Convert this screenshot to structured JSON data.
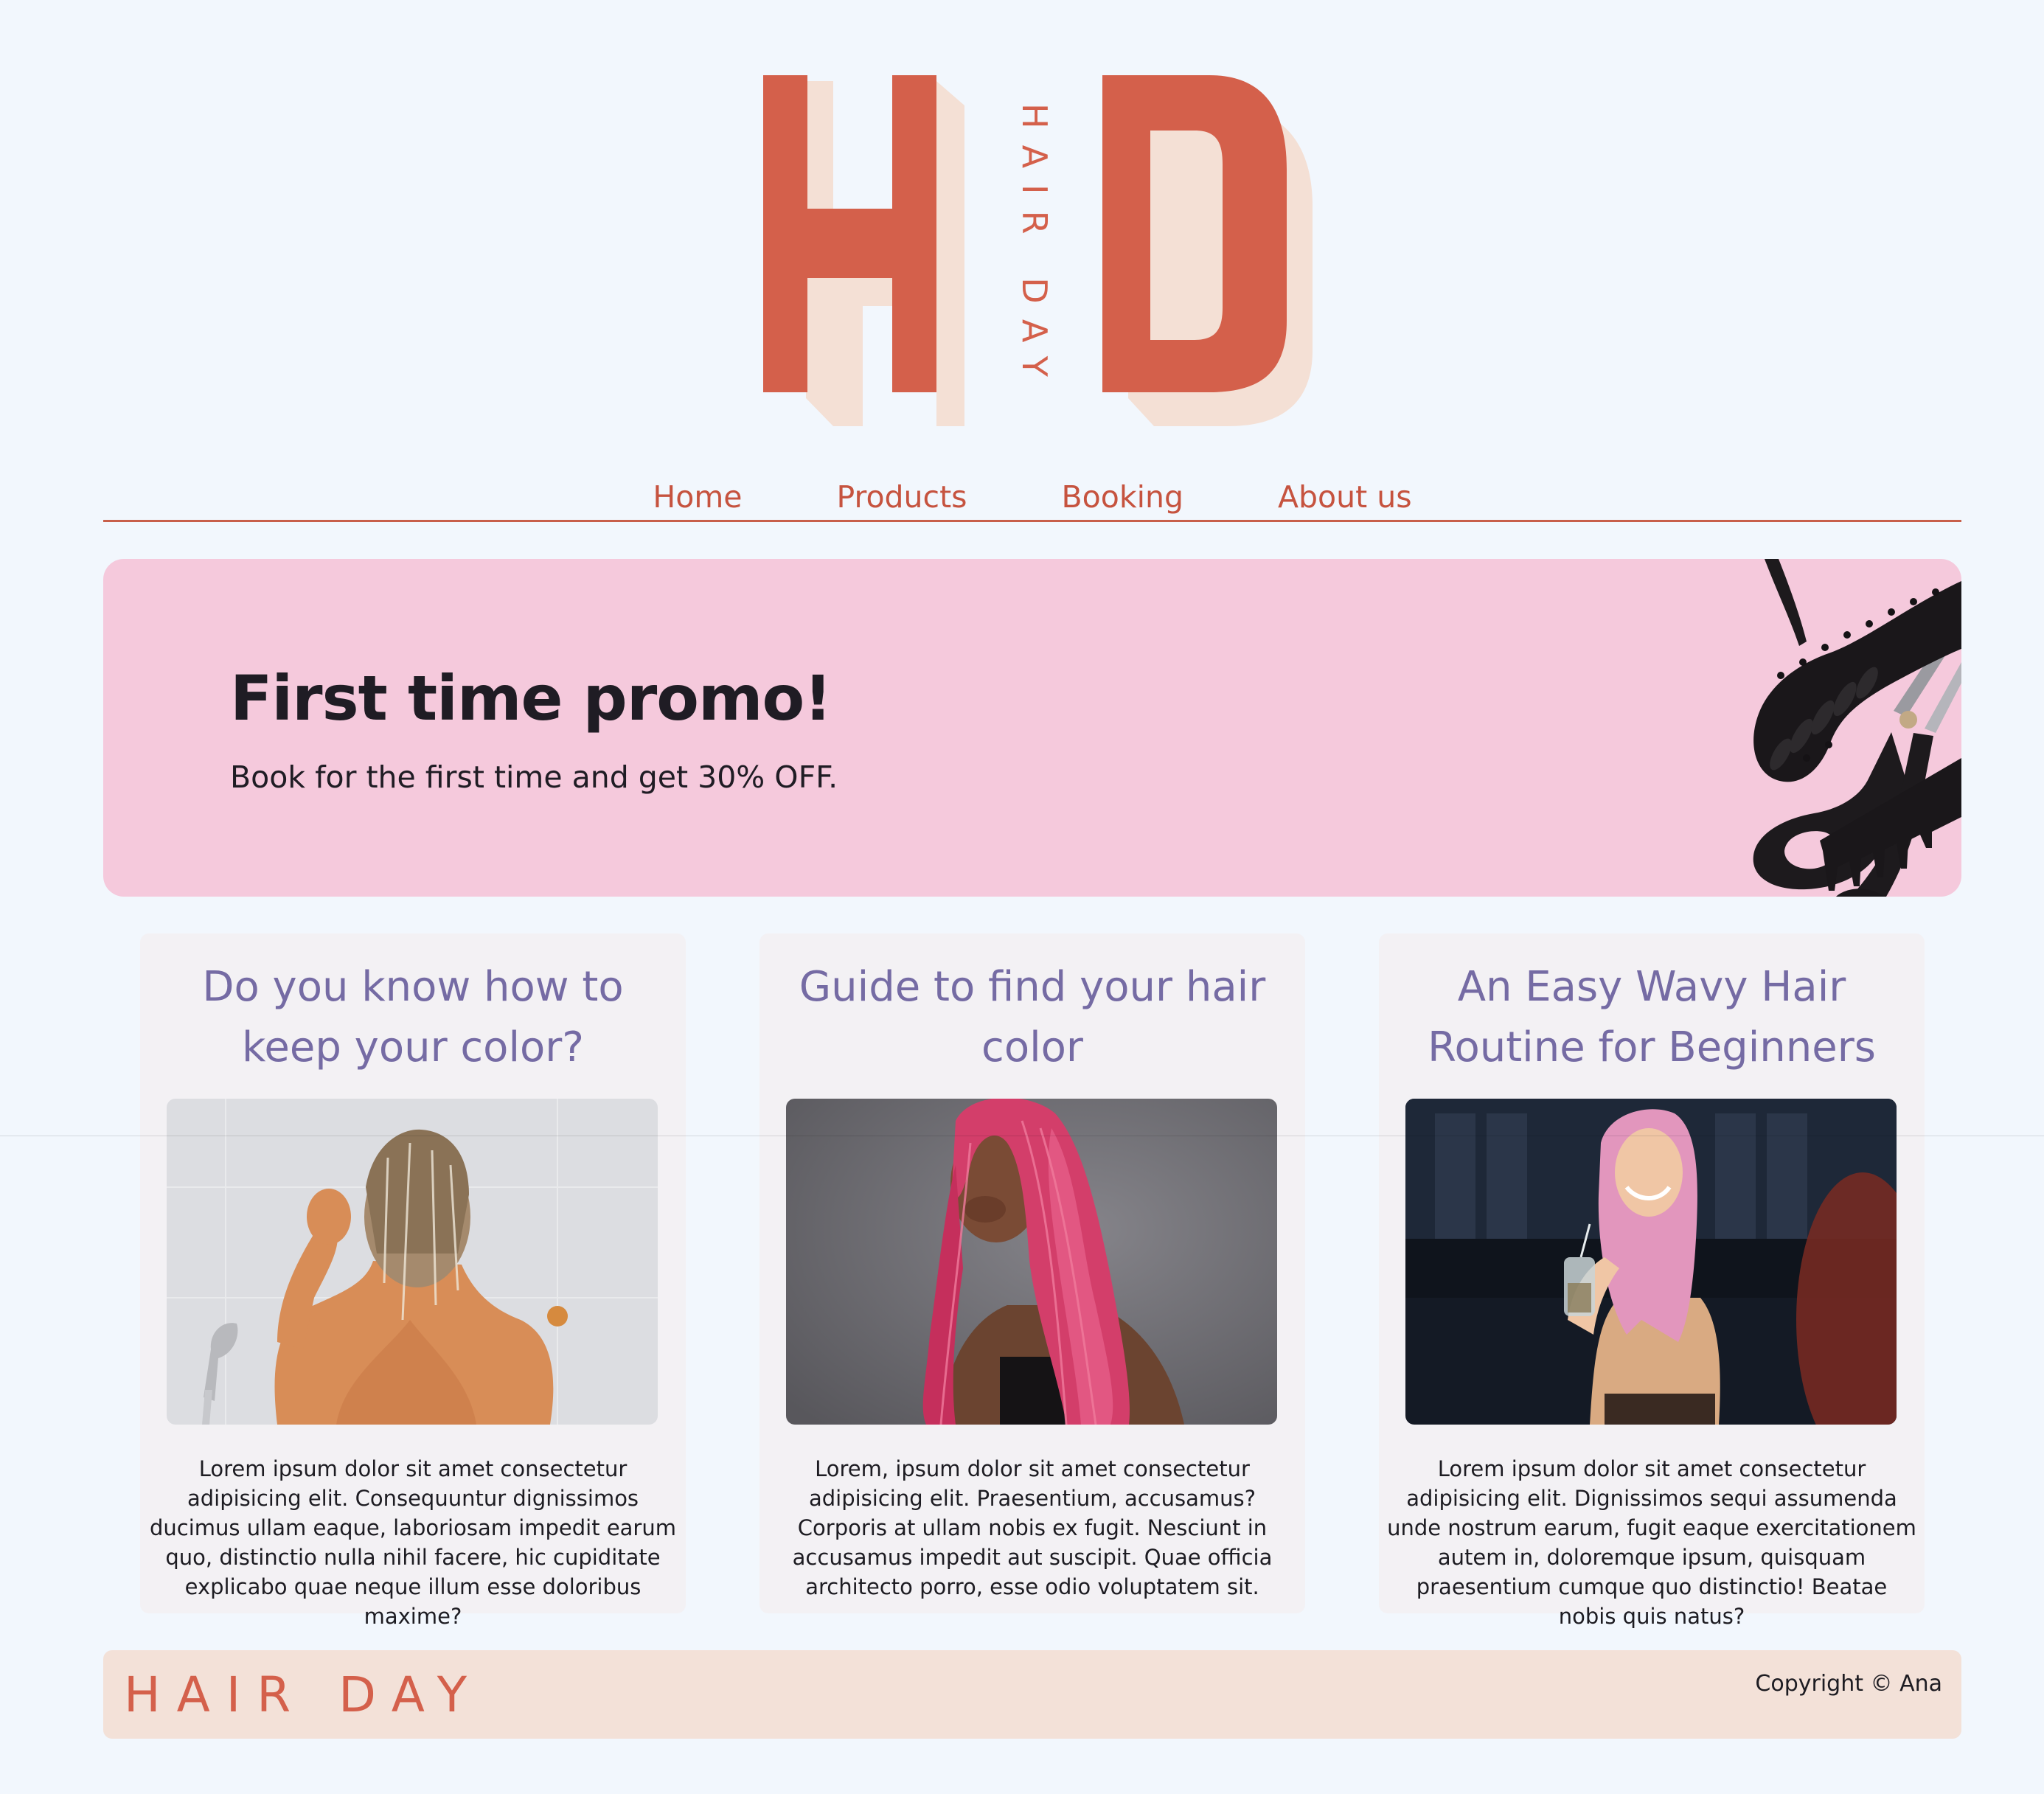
{
  "brand": {
    "logo_letter_left": "H",
    "logo_letter_right": "D",
    "logo_vertical_text": "HAIR DAY",
    "primary_color": "#d4604b",
    "shadow_color": "#f4e0d5"
  },
  "nav": {
    "items": [
      {
        "label": "Home"
      },
      {
        "label": "Products"
      },
      {
        "label": "Booking"
      },
      {
        "label": "About us"
      }
    ]
  },
  "promo": {
    "title": "First time promo!",
    "text": "Book for the first time and get 30% OFF.",
    "background": "#f5c9dc",
    "image_icons": [
      "scissors-icon",
      "hair-brush-icon",
      "comb-icon",
      "hair-clip-icon"
    ]
  },
  "cards": [
    {
      "title": "Do you know how to keep your color?",
      "image": "woman-in-shower-photo",
      "text": "Lorem ipsum dolor sit amet consectetur adipisicing elit. Consequuntur dignissimos ducimus ullam eaque, laboriosam impedit earum quo, distinctio nulla nihil facere, hic cupiditate explicabo quae neque illum esse doloribus maxime?"
    },
    {
      "title": "Guide to find your hair color",
      "image": "woman-pink-hair-photo",
      "text": "Lorem, ipsum dolor sit amet consectetur adipisicing elit. Praesentium, accusamus? Corporis at ullam nobis ex fugit. Nesciunt in accusamus impedit aut suscipit. Quae officia architecto porro, esse odio voluptatem sit."
    },
    {
      "title": "An Easy Wavy Hair Routine for Beginners",
      "image": "smiling-woman-pink-hair-photo",
      "text": "Lorem ipsum dolor sit amet consectetur adipisicing elit. Dignissimos sequi assumenda unde nostrum earum, fugit eaque exercitationem autem in, doloremque ipsum, quisquam praesentium cumque quo distinctio! Beatae nobis quis natus?"
    }
  ],
  "footer": {
    "brand": "HAIR DAY",
    "copyright": "Copyright © Ana",
    "background": "#f3e1d8"
  },
  "colors": {
    "page_background": "#f2f7fd",
    "card_background": "#f3f1f4",
    "card_title": "#756ba4",
    "nav_link": "#c6533f"
  }
}
